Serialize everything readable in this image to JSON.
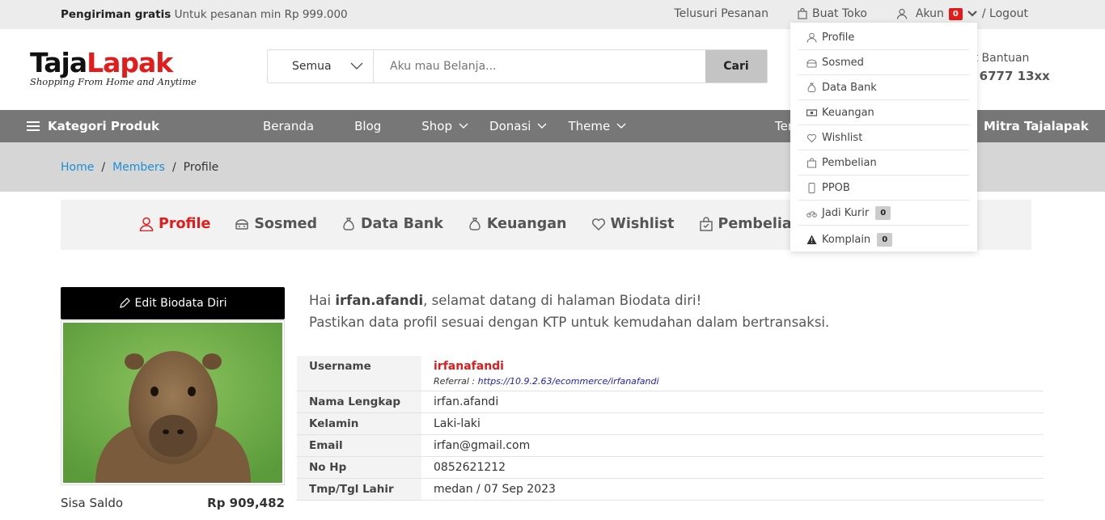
{
  "topbar": {
    "free_shipping_bold": "Pengiriman gratis",
    "free_shipping_text": "Untuk pesanan min Rp 999.000",
    "track_order": "Telusuri Pesanan",
    "open_store": "Buat Toko",
    "account": "Akun",
    "account_badge": "0",
    "logout": "/ Logout"
  },
  "header": {
    "logo_part1": "Taja",
    "logo_part2": "Lapak",
    "tagline": "Shopping From Home and Anytime",
    "search_category": "Semua",
    "search_placeholder": "Aku mau Belanja...",
    "search_button": "Cari",
    "help_label": "at Bantuan",
    "help_phone": "2 6777 13xx"
  },
  "nav": {
    "categories": "Kategori Produk",
    "items": [
      {
        "label": "Beranda"
      },
      {
        "label": "Blog"
      },
      {
        "label": "Shop"
      },
      {
        "label": "Donasi"
      },
      {
        "label": "Theme"
      }
    ],
    "partial_item": "Ter",
    "partner": "Mitra Tajalapak"
  },
  "breadcrumb": {
    "home": "Home",
    "members": "Members",
    "current": "Profile"
  },
  "tabs": [
    {
      "label": "Profile",
      "icon": "user-icon",
      "active": true
    },
    {
      "label": "Sosmed",
      "icon": "social-icon"
    },
    {
      "label": "Data Bank",
      "icon": "money-bag-icon"
    },
    {
      "label": "Keuangan",
      "icon": "money-bag-icon"
    },
    {
      "label": "Wishlist",
      "icon": "heart-icon"
    },
    {
      "label": "Pembelian",
      "icon": "shopping-bag-icon"
    }
  ],
  "account_menu": {
    "items": [
      {
        "label": "Profile",
        "icon": "user-icon"
      },
      {
        "label": "Sosmed",
        "icon": "social-icon"
      },
      {
        "label": "Data Bank",
        "icon": "money-bag-icon"
      },
      {
        "label": "Keuangan",
        "icon": "money-icon"
      },
      {
        "label": "Wishlist",
        "icon": "heart-icon"
      },
      {
        "label": "Pembelian",
        "icon": "shopping-bag-icon"
      },
      {
        "label": "PPOB",
        "icon": "mobile-icon"
      },
      {
        "label": "Jadi Kurir",
        "icon": "motorcycle-icon",
        "badge": "0"
      },
      {
        "label": "Komplain",
        "icon": "warning-icon",
        "badge": "0"
      }
    ]
  },
  "profile": {
    "edit_button": "Edit Biodata Diri",
    "balance_label": "Sisa Saldo",
    "balance_value": "Rp 909,482",
    "greeting_hi": "Hai",
    "greeting_user": "irfan.afandi",
    "greeting_rest": ", selamat datang di halaman Biodata diri!",
    "greeting_line2": "Pastikan data profil sesuai dengan KTP untuk kemudahan dalam bertransaksi.",
    "username_label": "Username",
    "username_value": "irfanafandi",
    "referral_label": "Referral :",
    "referral_url": "https://10.9.2.63/ecommerce/irfanafandi",
    "rows": [
      {
        "label": "Nama Lengkap",
        "value": "irfan.afandi"
      },
      {
        "label": "Kelamin",
        "value": "Laki-laki"
      },
      {
        "label": "Email",
        "value": "irfan@gmail.com"
      },
      {
        "label": "No Hp",
        "value": "0852621212"
      },
      {
        "label": "Tmp/Tgl Lahir",
        "value": "medan / 07 Sep 2023"
      }
    ]
  },
  "colors": {
    "accent": "#e31b1b",
    "nav_bg": "#777777",
    "link": "#1a8fd4"
  }
}
